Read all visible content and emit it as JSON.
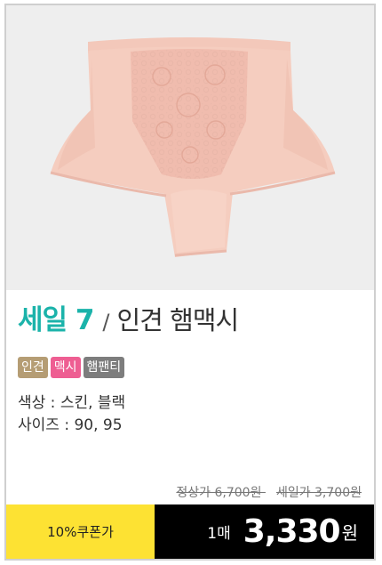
{
  "product": {
    "image_icon": "pink-lace-briefs-image",
    "sale_label": "세일 7",
    "slash": "/",
    "name": "인견 햄맥시",
    "tags": [
      "인견",
      "맥시",
      "햄팬티"
    ],
    "color_line": "색상 : 스킨, 블랙",
    "size_line": "사이즈 : 90, 95"
  },
  "pricing": {
    "regular_label": "정상가 6,700원",
    "sale_price_label": "세일가 3,700원",
    "coupon_label": "10%쿠폰가",
    "quantity_label": "1매",
    "final_price": "3,330",
    "currency": "원"
  },
  "colors": {
    "sale_accent": "#1bb3aa",
    "tag_rayon": "#b59d74",
    "tag_maxi": "#ee5e92",
    "tag_hem": "#7d7d7d",
    "coupon_bg": "#fde233",
    "price_bar_bg": "#000000"
  }
}
